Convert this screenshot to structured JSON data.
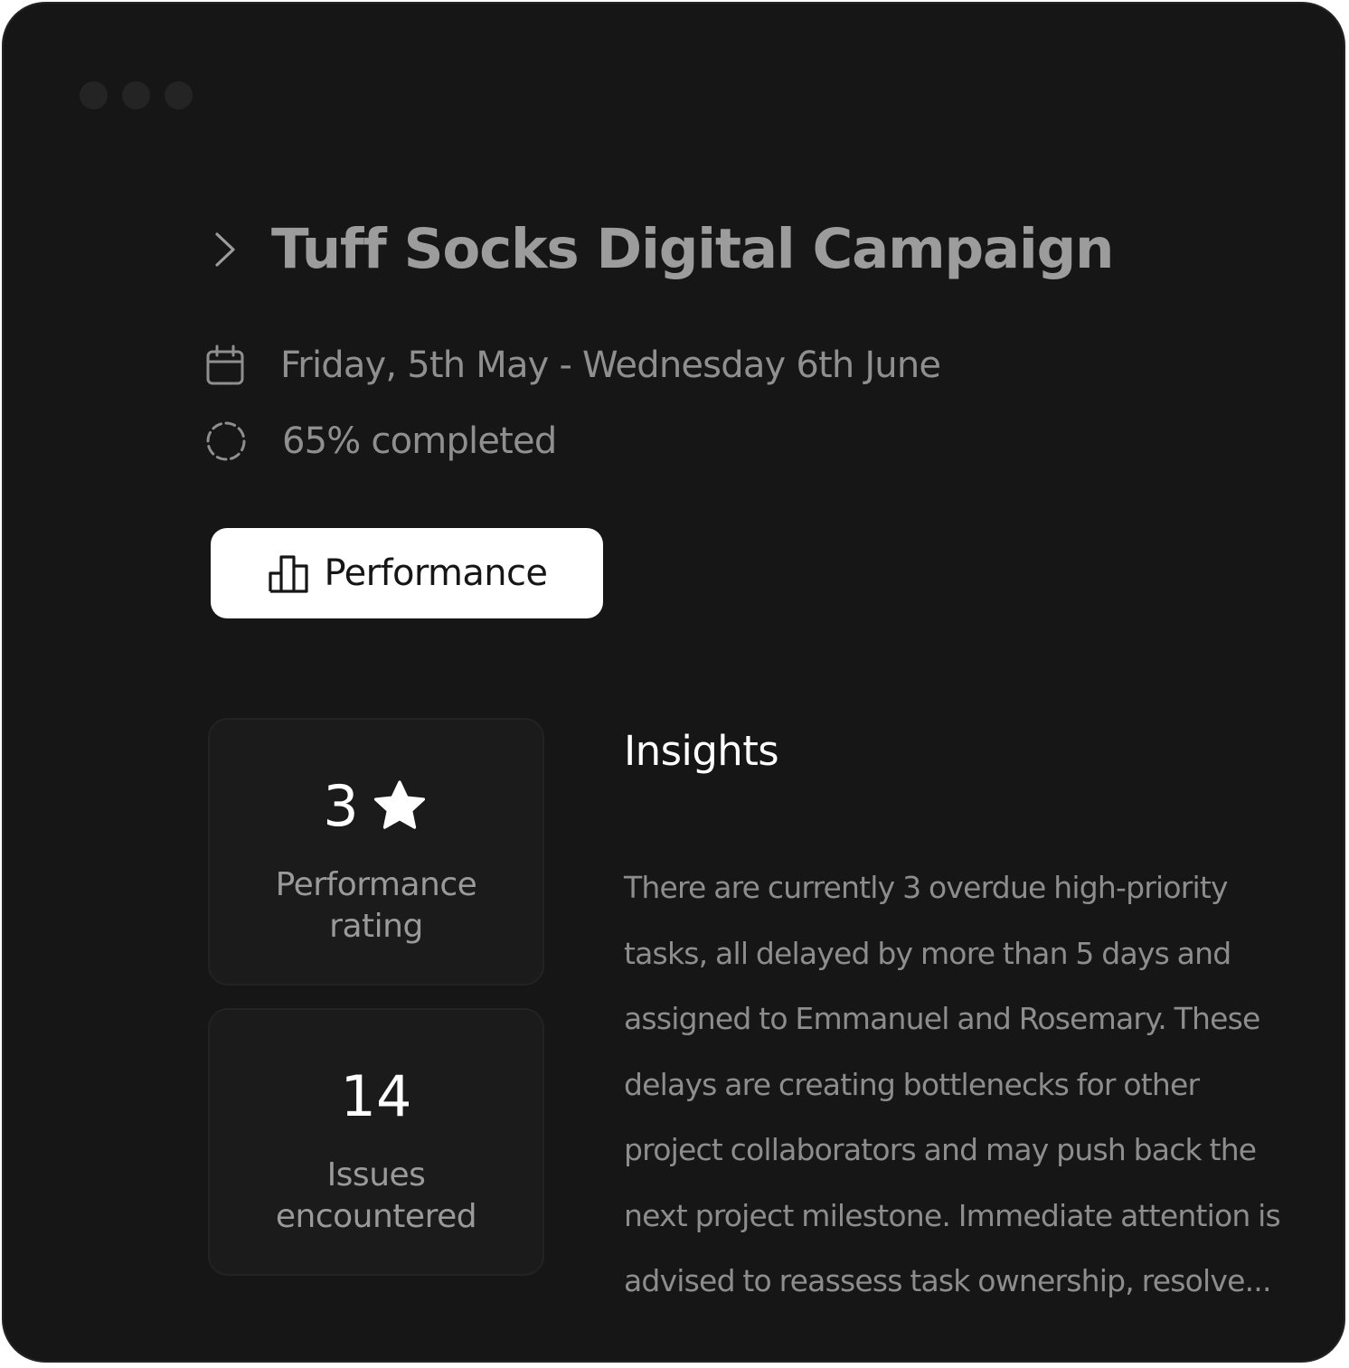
{
  "window": {
    "controls": [
      "window-dot",
      "window-dot",
      "window-dot"
    ]
  },
  "project": {
    "title": "Tuff Socks Digital Campaign",
    "date_range": "Friday, 5th May - Wednesday 6th June",
    "progress_text": "65% completed",
    "progress_value": 0.65
  },
  "tabs": {
    "performance_label": "Performance"
  },
  "stats": [
    {
      "value": "3",
      "label": "Performance rating",
      "icon": "star-icon"
    },
    {
      "value": "14",
      "label": "Issues encountered"
    }
  ],
  "insights": {
    "title": "Insights",
    "body": "There are currently 3 overdue high-priority tasks, all delayed by more than 5 days and assigned to Emmanuel and Rosemary. These delays are creating bottlenecks for other project collaborators and may push back the next project milestone. Immediate attention is advised to reassess task ownership, resolve..."
  },
  "colors": {
    "window_bg": "#161616",
    "card_bg": "#1b1b1b",
    "title_text": "#9c9c9c",
    "muted_text": "#8d8d8d",
    "primary_text": "#ffffff",
    "button_bg": "#ffffff"
  }
}
